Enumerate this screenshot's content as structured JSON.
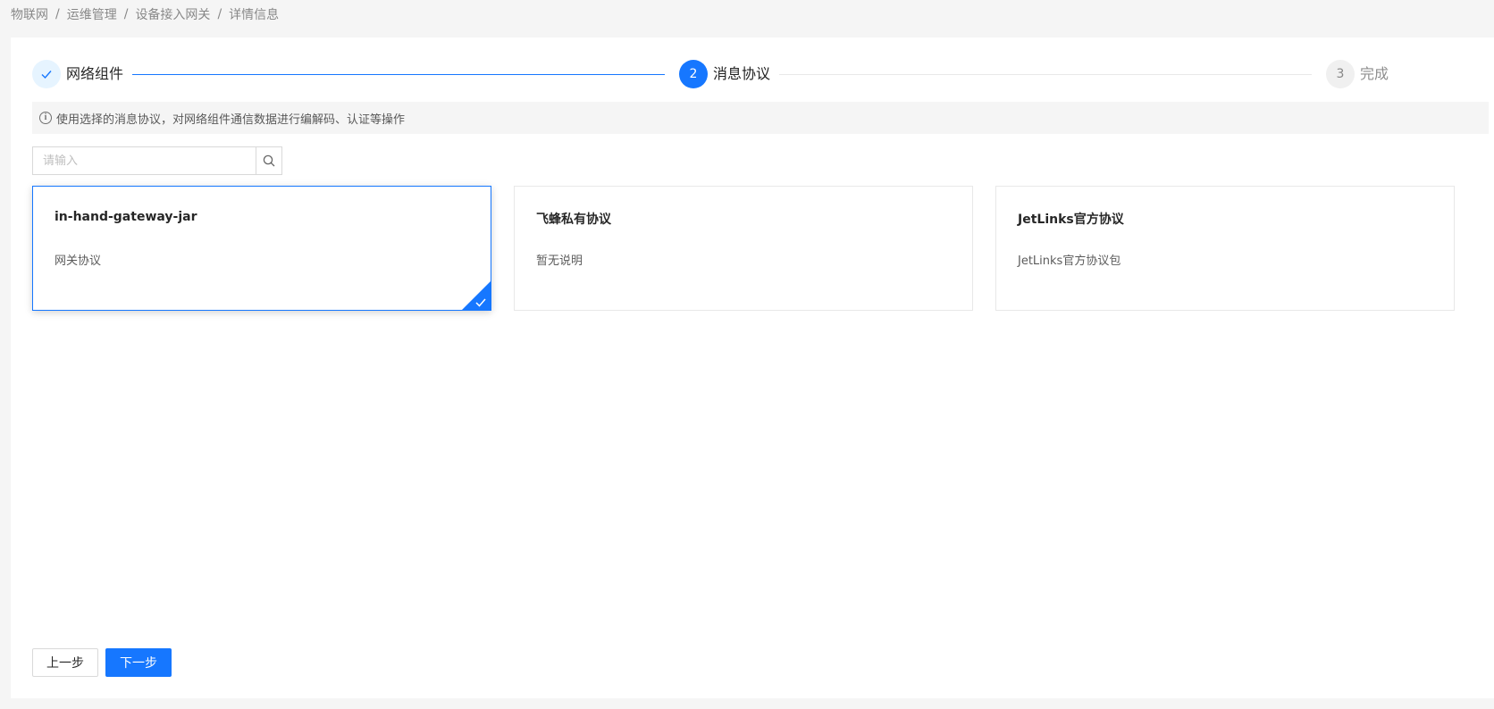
{
  "breadcrumb": {
    "items": [
      "物联网",
      "运维管理",
      "设备接入网关",
      "详情信息"
    ],
    "separator": "/"
  },
  "steps": [
    {
      "number": "1",
      "title": "网络组件",
      "status": "finished"
    },
    {
      "number": "2",
      "title": "消息协议",
      "status": "active"
    },
    {
      "number": "3",
      "title": "完成",
      "status": "waiting"
    }
  ],
  "alert": {
    "text": "使用选择的消息协议，对网络组件通信数据进行编解码、认证等操作",
    "icon": "info-circle-icon"
  },
  "search": {
    "placeholder": "请输入",
    "value": "",
    "icon": "search-icon"
  },
  "protocols": [
    {
      "name": "in-hand-gateway-jar",
      "description": "网关协议",
      "selected": true
    },
    {
      "name": "飞蜂私有协议",
      "description": "暂无说明",
      "selected": false
    },
    {
      "name": "JetLinks官方协议",
      "description": "JetLinks官方协议包",
      "selected": false
    }
  ],
  "actions": {
    "prev_label": "上一步",
    "next_label": "下一步"
  },
  "colors": {
    "primary": "#1677ff",
    "background": "#f5f5f5",
    "border": "#e8e8e8"
  }
}
